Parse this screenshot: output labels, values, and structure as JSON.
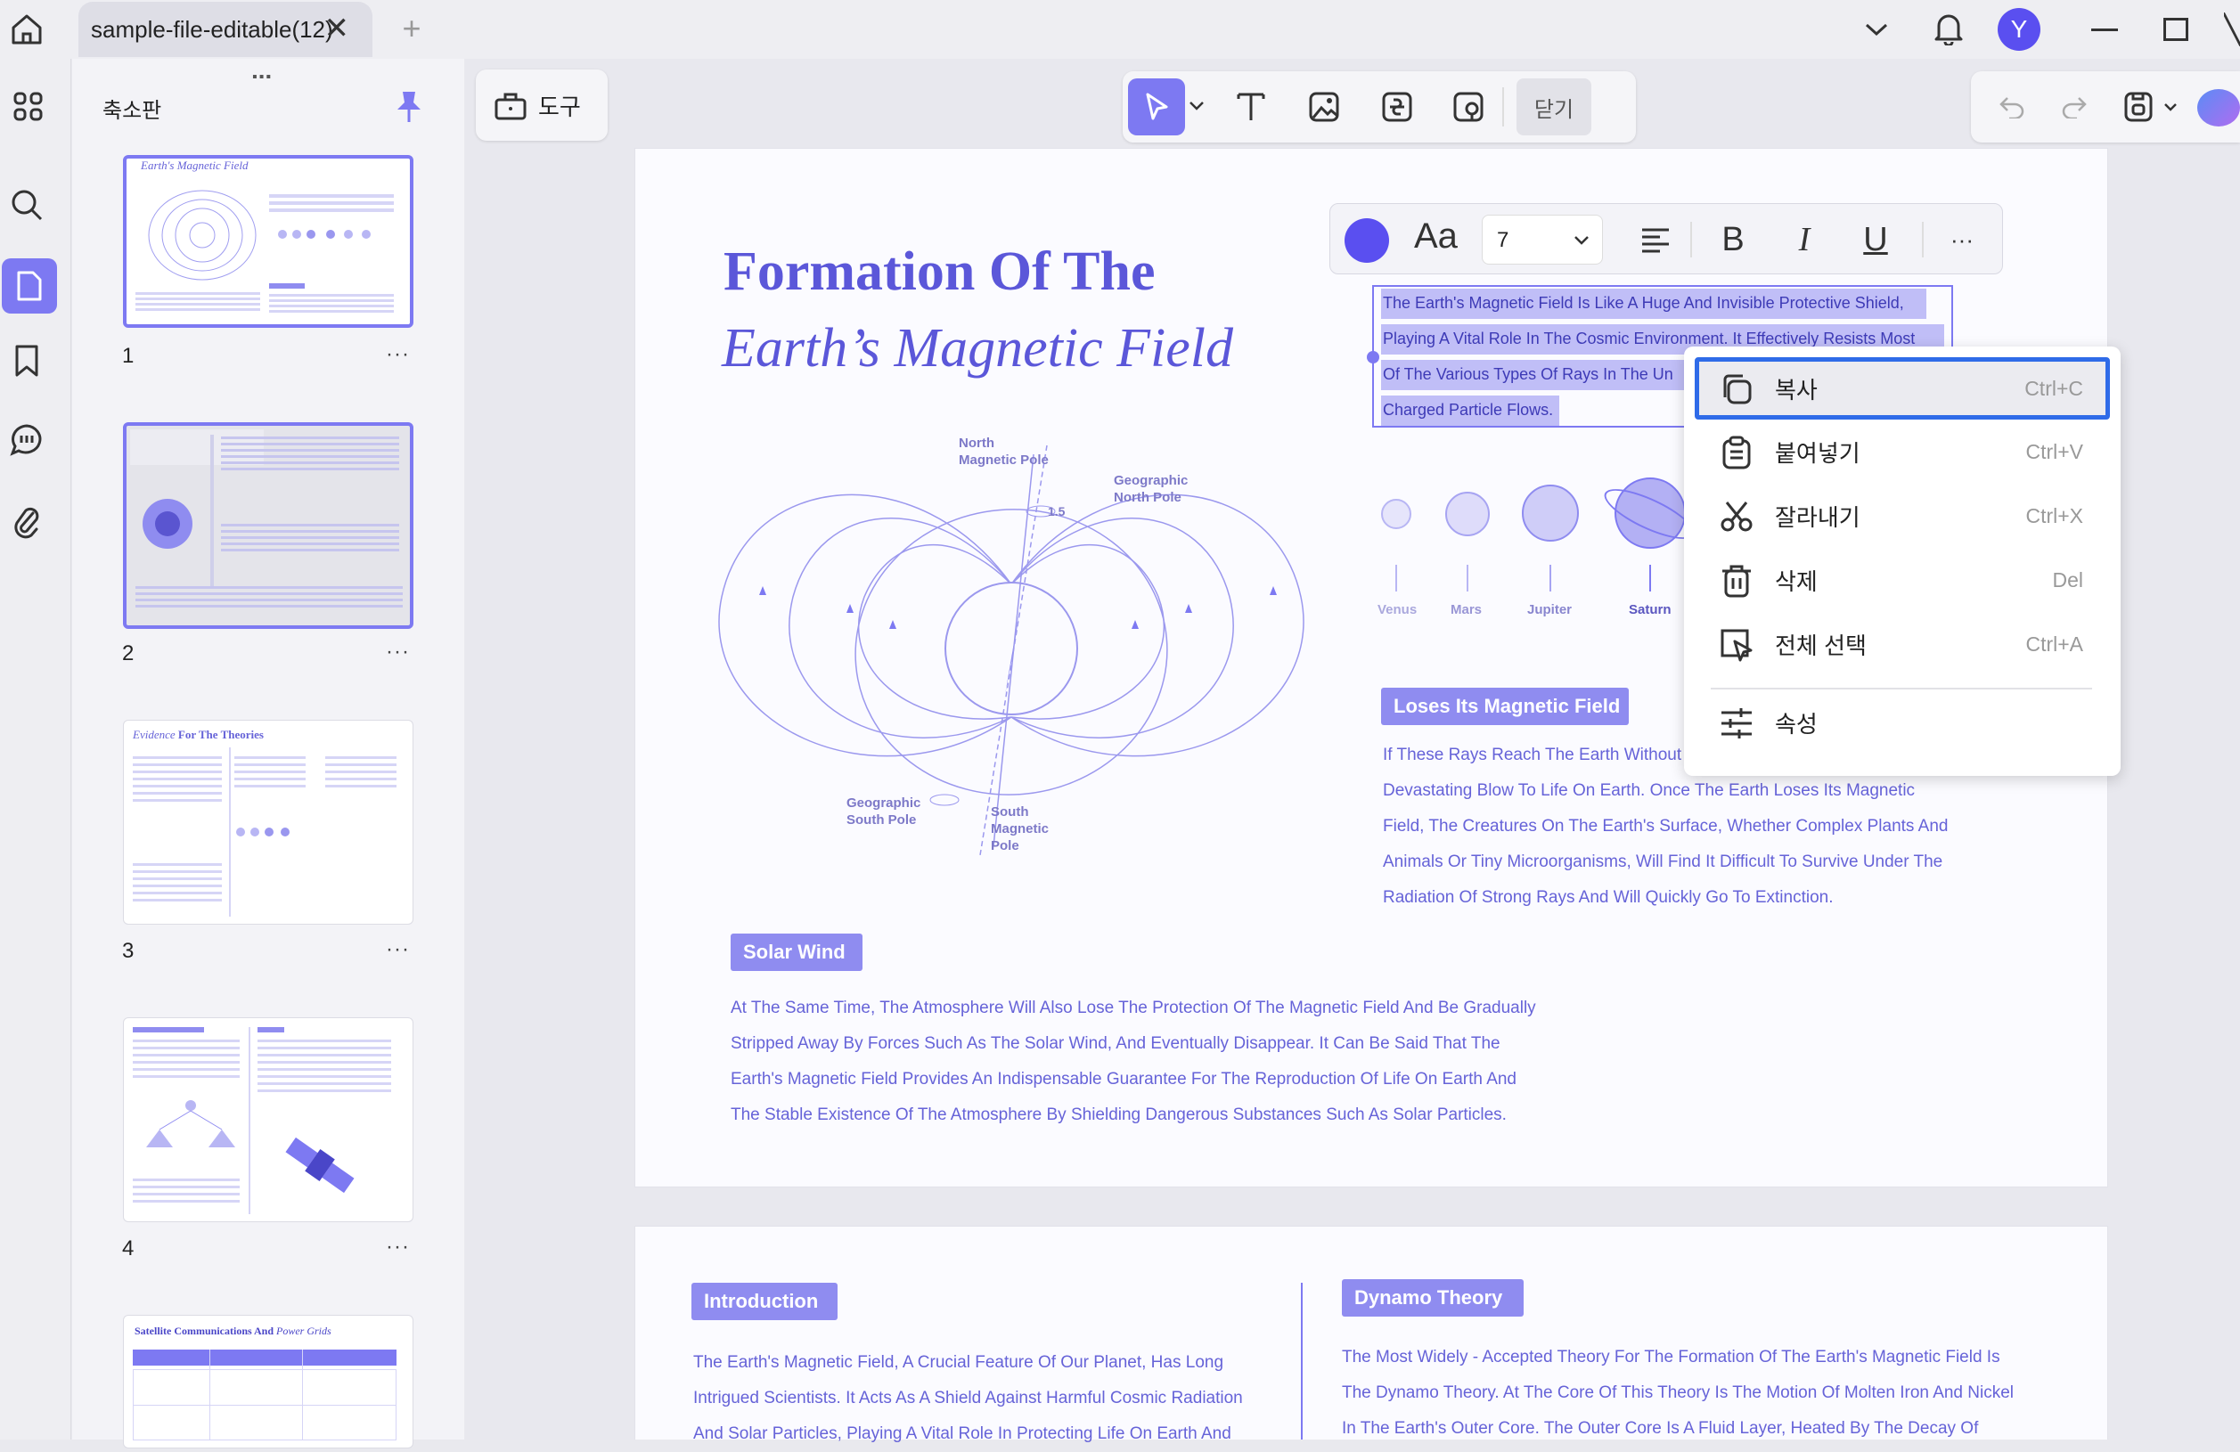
{
  "tab": {
    "title": "sample-file-editable(12)"
  },
  "user": {
    "avatar": "Y"
  },
  "colors": {
    "accent": "#7d79f2",
    "text_purple": "#6663d8",
    "label_bg": "#8f8cf0"
  },
  "thumbs": {
    "title": "축소판",
    "pages": [
      "1",
      "2",
      "3",
      "4"
    ],
    "dots": "···"
  },
  "toolbar": {
    "tool_label": "도구",
    "close_label": "닫기"
  },
  "format": {
    "font_size": "7",
    "more": "···"
  },
  "page1": {
    "title_line1": "Formation Of The",
    "title_line2": "Earth’s Magnetic Field",
    "selected": [
      "The Earth's Magnetic Field Is Like A Huge And Invisible Protective Shield,",
      "Playing A Vital Role In The Cosmic Environment. It Effectively Resists Most",
      "Of The Various Types Of Rays In The Un",
      "Charged Particle Flows."
    ],
    "diagram": {
      "north_mag": "North\nMagnetic Pole",
      "geo_north": "Geographic\nNorth Pole",
      "geo_south": "Geographic\nSouth Pole",
      "south_mag": "South\nMagnetic\nPole",
      "angle": "1.5"
    },
    "planets": [
      "Venus",
      "Mars",
      "Jupiter",
      "Saturn"
    ],
    "loses_label": "Loses Its Magnetic Field",
    "loses_text": [
      "If These Rays Reach The Earth Without C",
      "Devastating Blow To Life On Earth. Once The Earth Loses Its Magnetic",
      "Field, The Creatures On The Earth's Surface, Whether Complex Plants And",
      "Animals Or Tiny Microorganisms, Will Find It Difficult To Survive Under The",
      "Radiation Of Strong Rays And Will Quickly Go To Extinction."
    ],
    "solar_label": "Solar Wind",
    "solar_text": [
      "At The Same Time, The Atmosphere Will Also Lose The Protection Of The Magnetic Field And Be Gradually",
      "Stripped Away By Forces Such As The Solar Wind, And Eventually Disappear. It Can Be Said That The",
      "Earth's Magnetic Field Provides An Indispensable Guarantee For The Reproduction Of Life On Earth And",
      "The Stable Existence Of The Atmosphere By Shielding Dangerous Substances Such As Solar Particles."
    ]
  },
  "page2": {
    "intro_label": "Introduction",
    "intro_text": [
      "The Earth's Magnetic Field, A Crucial Feature Of Our Planet, Has Long",
      "Intrigued Scientists. It Acts As A Shield Against Harmful Cosmic Radiation",
      "And Solar Particles, Playing A Vital Role In Protecting Life On Earth And"
    ],
    "dynamo_label": "Dynamo Theory",
    "dynamo_text": [
      "The Most Widely - Accepted Theory For The Formation Of The Earth's Magnetic Field Is",
      "The Dynamo Theory. At The Core Of This Theory Is The Motion Of Molten Iron And Nickel",
      "In The Earth's Outer Core. The Outer Core Is A Fluid Layer, Heated By The Decay Of"
    ]
  },
  "context_menu": [
    {
      "label": "복사",
      "shortcut": "Ctrl+C"
    },
    {
      "label": "붙여넣기",
      "shortcut": "Ctrl+V"
    },
    {
      "label": "잘라내기",
      "shortcut": "Ctrl+X"
    },
    {
      "label": "삭제",
      "shortcut": "Del"
    },
    {
      "label": "전체 선택",
      "shortcut": "Ctrl+A"
    },
    {
      "label": "속성",
      "shortcut": ""
    }
  ]
}
